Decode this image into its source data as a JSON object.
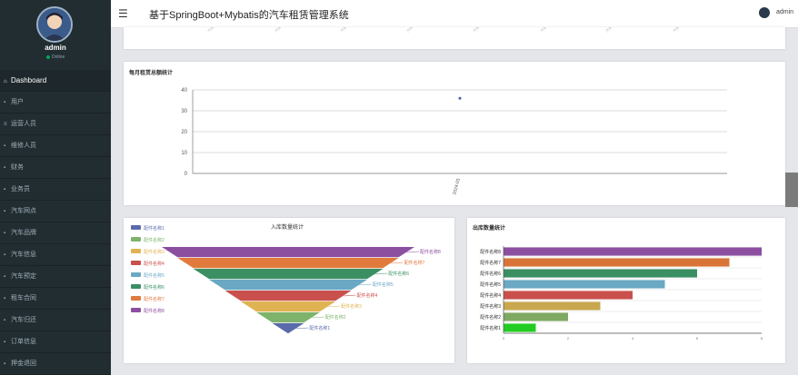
{
  "app": {
    "title": "基于SpringBoot+Mybatis的汽车租赁管理系统"
  },
  "user": {
    "name": "admin",
    "status": "Online",
    "top_name": "admin"
  },
  "nav": [
    {
      "icon": "⌂",
      "label": "Dashboard",
      "active": true
    },
    {
      "icon": "▪",
      "label": "用户"
    },
    {
      "icon": "≡",
      "label": "运营人员"
    },
    {
      "icon": "▪",
      "label": "维修人员"
    },
    {
      "icon": "▪",
      "label": "财务"
    },
    {
      "icon": "▪",
      "label": "业务员"
    },
    {
      "icon": "▪",
      "label": "汽车网点"
    },
    {
      "icon": "▪",
      "label": "汽车品牌"
    },
    {
      "icon": "▪",
      "label": "汽车信息"
    },
    {
      "icon": "▪",
      "label": "汽车预定"
    },
    {
      "icon": "▪",
      "label": "租车合同"
    },
    {
      "icon": "▪",
      "label": "汽车归还"
    },
    {
      "icon": "▪",
      "label": "订单信息"
    },
    {
      "icon": "▪",
      "label": "押金退回"
    }
  ],
  "chart_data": [
    {
      "type": "line",
      "title": "每月租赁总额统计",
      "categories": [
        "2024-03"
      ],
      "values": [
        36
      ],
      "ylim": [
        0,
        40
      ],
      "yticks": [
        0,
        10,
        20,
        30,
        40
      ],
      "grid": true
    },
    {
      "type": "funnel",
      "title": "入库数量统计",
      "legend": "left",
      "categories": [
        "配件名称1",
        "配件名称2",
        "配件名称3",
        "配件名称4",
        "配件名称5",
        "配件名称6",
        "配件名称7",
        "配件名称8"
      ],
      "values": [
        1,
        2,
        3,
        4,
        5,
        6,
        7,
        8
      ],
      "colors": [
        "#5a6aaa",
        "#7eb36c",
        "#e0b352",
        "#c9504c",
        "#6aa8c3",
        "#3a8f63",
        "#e07a3d",
        "#8c4fa0"
      ]
    },
    {
      "type": "bar",
      "orientation": "horizontal",
      "title": "出库数量统计",
      "categories": [
        "配件名称1",
        "配件名称2",
        "配件名称3",
        "配件名称4",
        "配件名称5",
        "配件名称6",
        "配件名称7",
        "配件名称8"
      ],
      "values": [
        1,
        2,
        3,
        4,
        5,
        6,
        7,
        8
      ],
      "xlim": [
        0,
        8
      ],
      "colors": [
        "#22cc22",
        "#7fa862",
        "#c8a74e",
        "#c9504c",
        "#6aa8c3",
        "#3a8f63",
        "#d87438",
        "#8c4fa0"
      ]
    }
  ]
}
